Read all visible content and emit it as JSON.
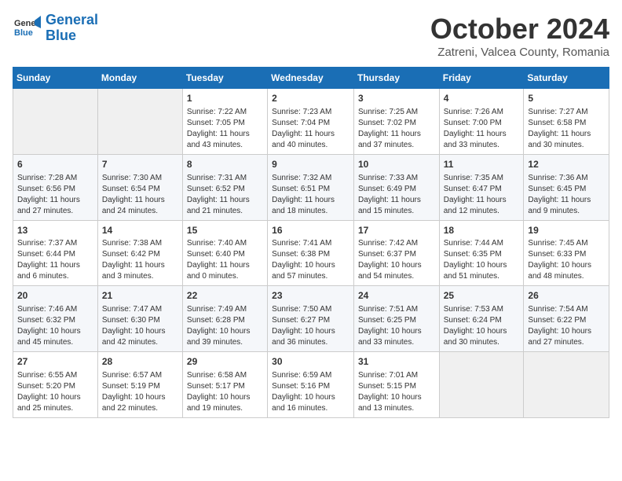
{
  "header": {
    "logo_general": "General",
    "logo_blue": "Blue",
    "month": "October 2024",
    "location": "Zatreni, Valcea County, Romania"
  },
  "days_of_week": [
    "Sunday",
    "Monday",
    "Tuesday",
    "Wednesday",
    "Thursday",
    "Friday",
    "Saturday"
  ],
  "weeks": [
    [
      {
        "day": "",
        "content": ""
      },
      {
        "day": "",
        "content": ""
      },
      {
        "day": "1",
        "content": "Sunrise: 7:22 AM\nSunset: 7:05 PM\nDaylight: 11 hours\nand 43 minutes."
      },
      {
        "day": "2",
        "content": "Sunrise: 7:23 AM\nSunset: 7:04 PM\nDaylight: 11 hours\nand 40 minutes."
      },
      {
        "day": "3",
        "content": "Sunrise: 7:25 AM\nSunset: 7:02 PM\nDaylight: 11 hours\nand 37 minutes."
      },
      {
        "day": "4",
        "content": "Sunrise: 7:26 AM\nSunset: 7:00 PM\nDaylight: 11 hours\nand 33 minutes."
      },
      {
        "day": "5",
        "content": "Sunrise: 7:27 AM\nSunset: 6:58 PM\nDaylight: 11 hours\nand 30 minutes."
      }
    ],
    [
      {
        "day": "6",
        "content": "Sunrise: 7:28 AM\nSunset: 6:56 PM\nDaylight: 11 hours\nand 27 minutes."
      },
      {
        "day": "7",
        "content": "Sunrise: 7:30 AM\nSunset: 6:54 PM\nDaylight: 11 hours\nand 24 minutes."
      },
      {
        "day": "8",
        "content": "Sunrise: 7:31 AM\nSunset: 6:52 PM\nDaylight: 11 hours\nand 21 minutes."
      },
      {
        "day": "9",
        "content": "Sunrise: 7:32 AM\nSunset: 6:51 PM\nDaylight: 11 hours\nand 18 minutes."
      },
      {
        "day": "10",
        "content": "Sunrise: 7:33 AM\nSunset: 6:49 PM\nDaylight: 11 hours\nand 15 minutes."
      },
      {
        "day": "11",
        "content": "Sunrise: 7:35 AM\nSunset: 6:47 PM\nDaylight: 11 hours\nand 12 minutes."
      },
      {
        "day": "12",
        "content": "Sunrise: 7:36 AM\nSunset: 6:45 PM\nDaylight: 11 hours\nand 9 minutes."
      }
    ],
    [
      {
        "day": "13",
        "content": "Sunrise: 7:37 AM\nSunset: 6:44 PM\nDaylight: 11 hours\nand 6 minutes."
      },
      {
        "day": "14",
        "content": "Sunrise: 7:38 AM\nSunset: 6:42 PM\nDaylight: 11 hours\nand 3 minutes."
      },
      {
        "day": "15",
        "content": "Sunrise: 7:40 AM\nSunset: 6:40 PM\nDaylight: 11 hours\nand 0 minutes."
      },
      {
        "day": "16",
        "content": "Sunrise: 7:41 AM\nSunset: 6:38 PM\nDaylight: 10 hours\nand 57 minutes."
      },
      {
        "day": "17",
        "content": "Sunrise: 7:42 AM\nSunset: 6:37 PM\nDaylight: 10 hours\nand 54 minutes."
      },
      {
        "day": "18",
        "content": "Sunrise: 7:44 AM\nSunset: 6:35 PM\nDaylight: 10 hours\nand 51 minutes."
      },
      {
        "day": "19",
        "content": "Sunrise: 7:45 AM\nSunset: 6:33 PM\nDaylight: 10 hours\nand 48 minutes."
      }
    ],
    [
      {
        "day": "20",
        "content": "Sunrise: 7:46 AM\nSunset: 6:32 PM\nDaylight: 10 hours\nand 45 minutes."
      },
      {
        "day": "21",
        "content": "Sunrise: 7:47 AM\nSunset: 6:30 PM\nDaylight: 10 hours\nand 42 minutes."
      },
      {
        "day": "22",
        "content": "Sunrise: 7:49 AM\nSunset: 6:28 PM\nDaylight: 10 hours\nand 39 minutes."
      },
      {
        "day": "23",
        "content": "Sunrise: 7:50 AM\nSunset: 6:27 PM\nDaylight: 10 hours\nand 36 minutes."
      },
      {
        "day": "24",
        "content": "Sunrise: 7:51 AM\nSunset: 6:25 PM\nDaylight: 10 hours\nand 33 minutes."
      },
      {
        "day": "25",
        "content": "Sunrise: 7:53 AM\nSunset: 6:24 PM\nDaylight: 10 hours\nand 30 minutes."
      },
      {
        "day": "26",
        "content": "Sunrise: 7:54 AM\nSunset: 6:22 PM\nDaylight: 10 hours\nand 27 minutes."
      }
    ],
    [
      {
        "day": "27",
        "content": "Sunrise: 6:55 AM\nSunset: 5:20 PM\nDaylight: 10 hours\nand 25 minutes."
      },
      {
        "day": "28",
        "content": "Sunrise: 6:57 AM\nSunset: 5:19 PM\nDaylight: 10 hours\nand 22 minutes."
      },
      {
        "day": "29",
        "content": "Sunrise: 6:58 AM\nSunset: 5:17 PM\nDaylight: 10 hours\nand 19 minutes."
      },
      {
        "day": "30",
        "content": "Sunrise: 6:59 AM\nSunset: 5:16 PM\nDaylight: 10 hours\nand 16 minutes."
      },
      {
        "day": "31",
        "content": "Sunrise: 7:01 AM\nSunset: 5:15 PM\nDaylight: 10 hours\nand 13 minutes."
      },
      {
        "day": "",
        "content": ""
      },
      {
        "day": "",
        "content": ""
      }
    ]
  ]
}
